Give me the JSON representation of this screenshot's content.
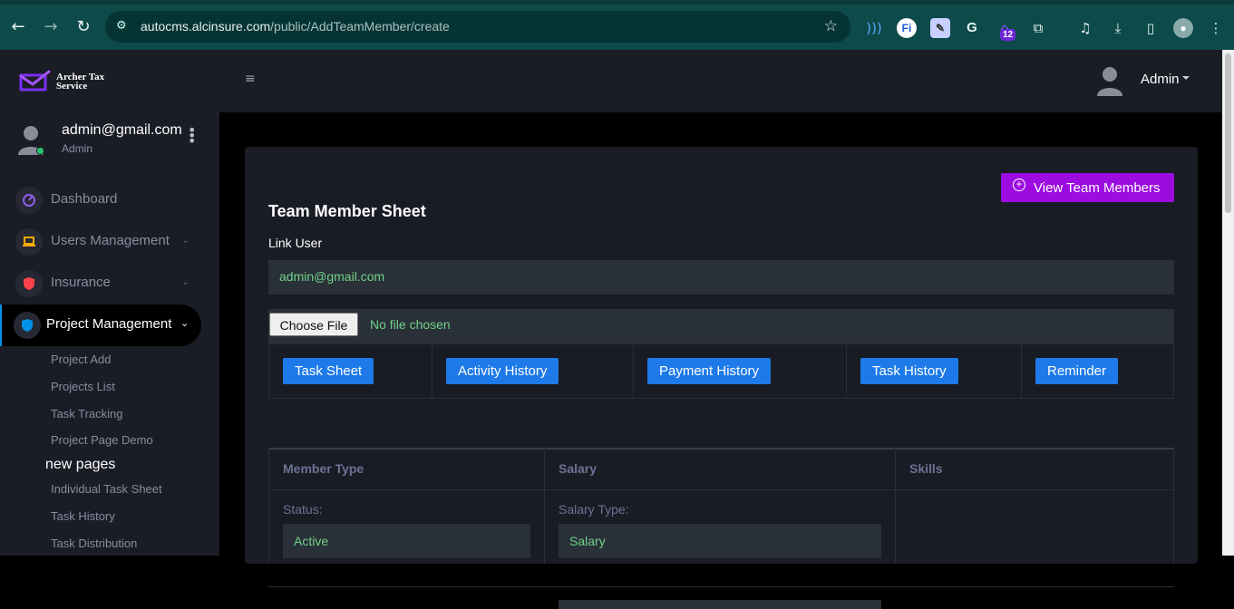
{
  "browser": {
    "url_domain": "autocms.alcinsure.com",
    "url_path": "/public/AddTeamMember/create",
    "extension_badge": "12"
  },
  "brand": {
    "name_line1": "Archer Tax",
    "name_line2": "Service"
  },
  "header": {
    "user_label": "Admin"
  },
  "sidebar": {
    "user": {
      "email": "admin@gmail.com",
      "role": "Admin"
    },
    "items": [
      {
        "label": "Dashboard",
        "icon": "speedometer-icon",
        "color": "#8f5fe8"
      },
      {
        "label": "Users Management",
        "icon": "laptop-icon",
        "color": "#ffab00"
      },
      {
        "label": "Insurance",
        "icon": "security-icon",
        "color": "#fc424a"
      },
      {
        "label": "Project Management",
        "icon": "shield-icon",
        "color": "#0090e7"
      }
    ],
    "subitems": [
      "Project Add",
      "Projects List",
      "Task Tracking",
      "Project Page Demo"
    ],
    "section_heading": "new pages",
    "subitems2": [
      "Individual Task Sheet",
      "Task History",
      "Task Distribution"
    ]
  },
  "main": {
    "view_button": "View Team Members",
    "title": "Team Member Sheet",
    "link_user_label": "Link User",
    "link_user_value": "admin@gmail.com",
    "choose_file": "Choose File",
    "no_file": "No file chosen",
    "tabs": [
      "Task Sheet",
      "Activity History",
      "Payment History",
      "Task History",
      "Reminder"
    ],
    "columns": [
      "Member Type",
      "Salary",
      "Skills"
    ],
    "status_label": "Status:",
    "status_value": "Active",
    "salary_type_label": "Salary Type:",
    "salary_type_value": "Salary"
  },
  "colors": {
    "accent_purple": "#9c0ce0",
    "tab_blue": "#1e7ae8",
    "success_green": "#6fd38a",
    "sidebar_bg": "#1b1d26",
    "card_bg": "#191c24"
  }
}
